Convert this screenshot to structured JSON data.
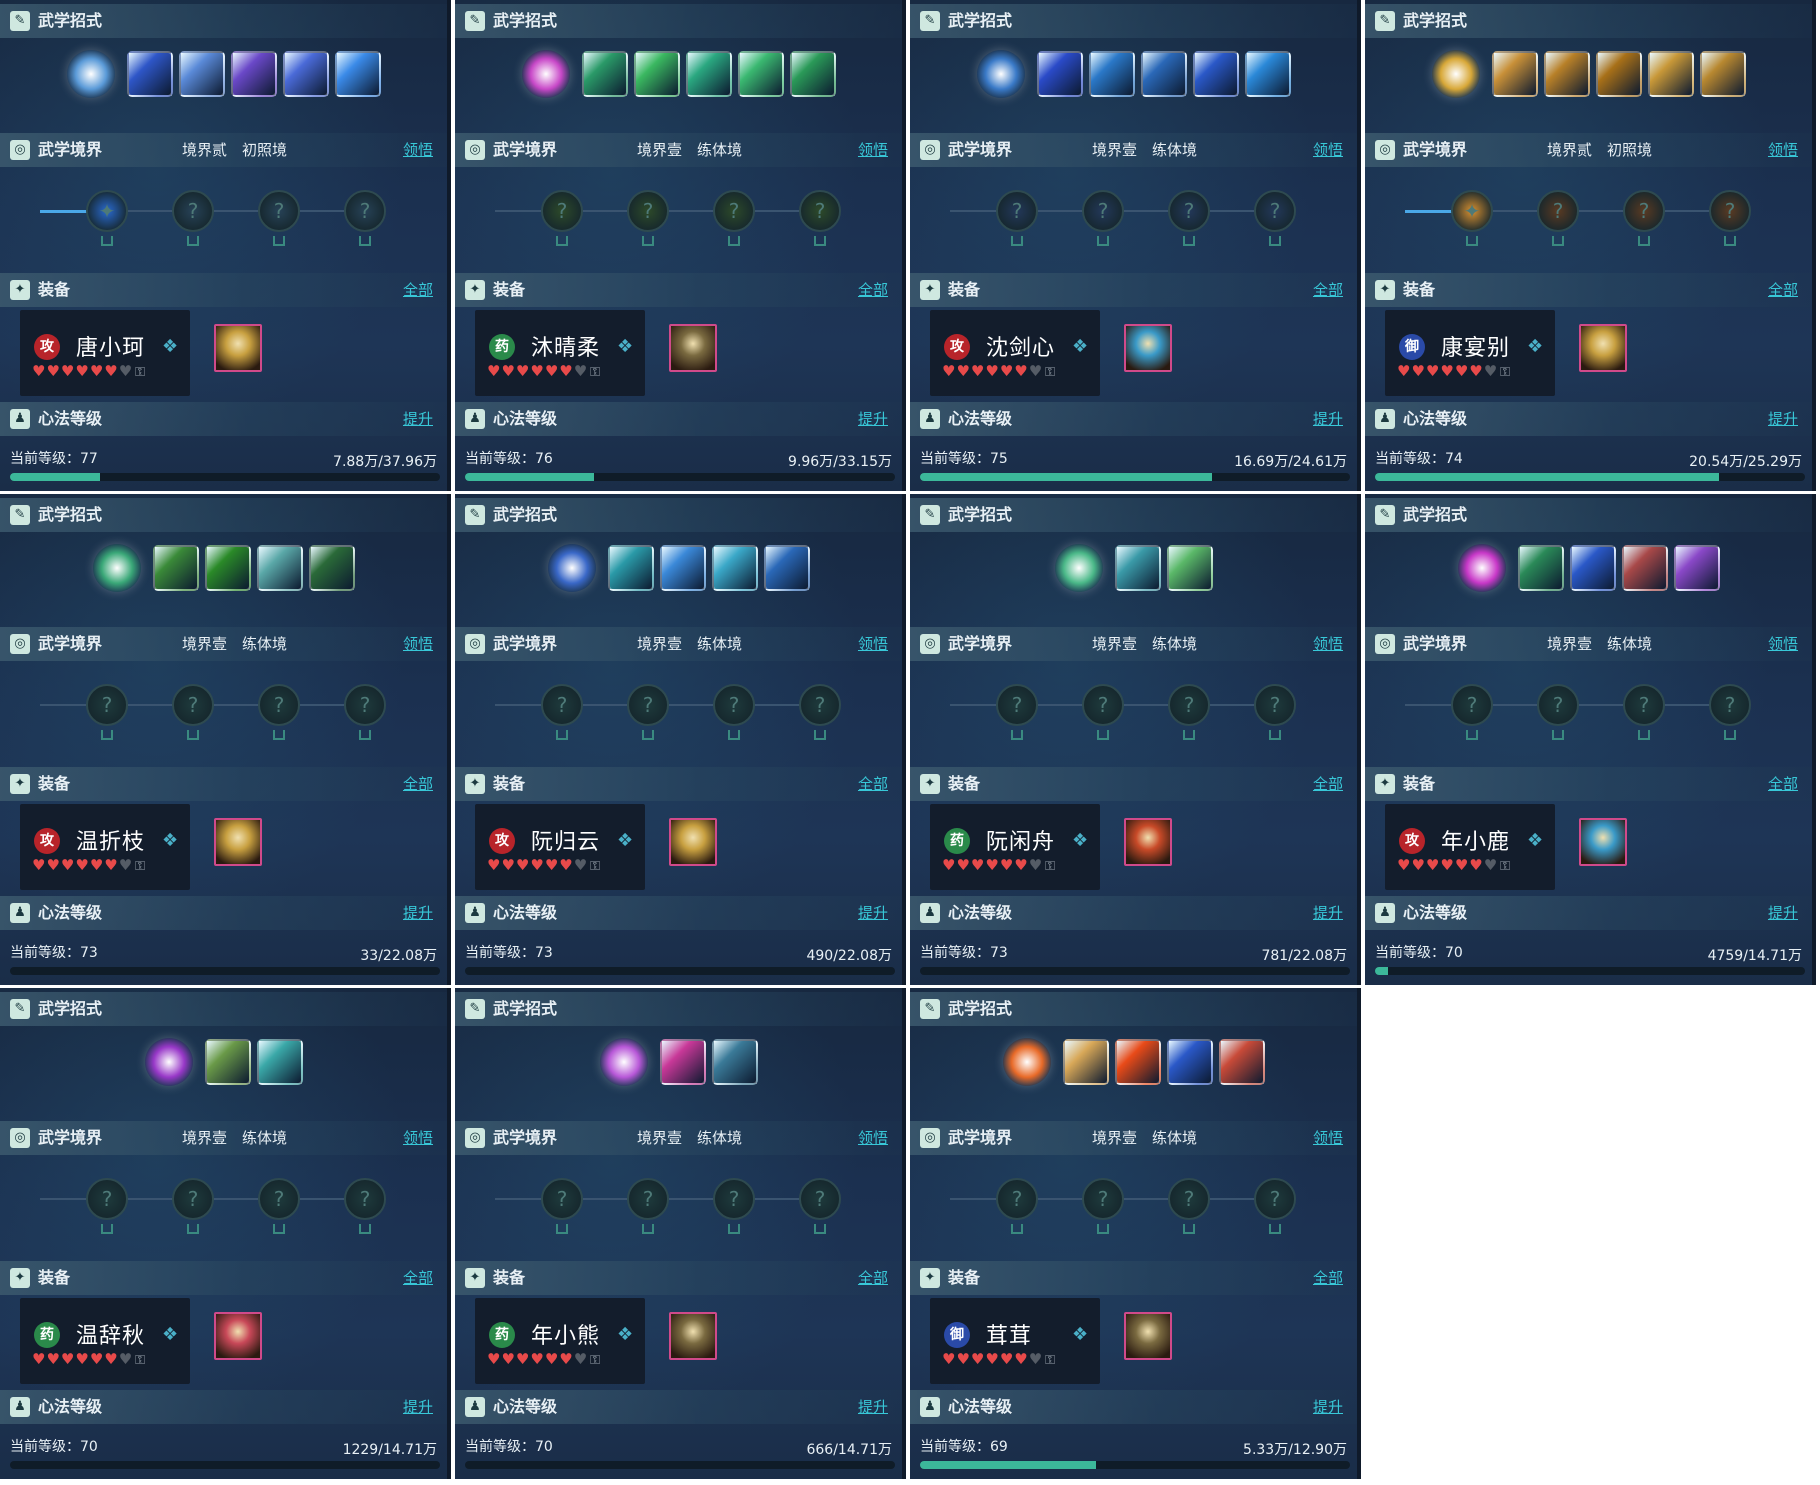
{
  "labels": {
    "skills": "武学招式",
    "realm": "武学境界",
    "equip": "装备",
    "equip_all": "全部",
    "realm_link": "领悟",
    "heart": "心法等级",
    "heart_link": "提升",
    "level_prefix": "当前等级："
  },
  "panels": [
    {
      "name": "唐小珂",
      "class_badge": "攻",
      "badge_color": "#b8242a",
      "realm_tier": "境界贰",
      "realm_stage": "初照境",
      "realm_active": true,
      "level": "77",
      "exp": "7.88万/37.96万",
      "progress": 0.21,
      "hearts_full": 6,
      "hearts_empty": 1,
      "skill_main_color": "#5a9ad8",
      "skill_colors": [
        "#2e56c8",
        "#5a8ad8",
        "#6a48c8",
        "#4a6ad8",
        "#3a8ae8"
      ],
      "node_colors": [
        "#2a6ad0",
        "#274257",
        "#274257",
        "#274257"
      ],
      "gear_color": "#c8a040"
    },
    {
      "name": "沐晴柔",
      "class_badge": "药",
      "badge_color": "#2a8a4a",
      "realm_tier": "境界壹",
      "realm_stage": "练体境",
      "realm_active": false,
      "level": "76",
      "exp": "9.96万/33.15万",
      "progress": 0.3,
      "hearts_full": 6,
      "hearts_empty": 1,
      "skill_main_color": "#c848c8",
      "skill_colors": [
        "#2a9a68",
        "#3ab860",
        "#2aa880",
        "#3ab870",
        "#2a9a58"
      ],
      "node_colors": [
        "#2d4a2a",
        "#2d4a2a",
        "#2d4a2a",
        "#2d4a2a"
      ],
      "gear_color": "#7a6a40"
    },
    {
      "name": "沈剑心",
      "class_badge": "攻",
      "badge_color": "#b8242a",
      "realm_tier": "境界壹",
      "realm_stage": "练体境",
      "realm_active": false,
      "level": "75",
      "exp": "16.69万/24.61万",
      "progress": 0.68,
      "hearts_full": 6,
      "hearts_empty": 1,
      "skill_main_color": "#3a7ac8",
      "skill_colors": [
        "#2a4ac8",
        "#2a78c8",
        "#2a68b8",
        "#2a58c8",
        "#2a88d8"
      ],
      "node_colors": [
        "#23385a",
        "#23385a",
        "#23385a",
        "#23385a"
      ],
      "gear_color": "#3a9ac8"
    },
    {
      "name": "康宴别",
      "class_badge": "御",
      "badge_color": "#2a4aa8",
      "realm_tier": "境界贰",
      "realm_stage": "初照境",
      "realm_active": true,
      "level": "74",
      "exp": "20.54万/25.29万",
      "progress": 0.8,
      "hearts_full": 6,
      "hearts_empty": 1,
      "skill_main_color": "#d8a838",
      "skill_colors": [
        "#c89038",
        "#b88028",
        "#a87018",
        "#c89838",
        "#b88830"
      ],
      "node_colors": [
        "#d89030",
        "#5a3a22",
        "#5a3a22",
        "#5a3a22"
      ],
      "gear_color": "#c8a040"
    },
    {
      "name": "温折枝",
      "class_badge": "攻",
      "badge_color": "#b8242a",
      "realm_tier": "境界壹",
      "realm_stage": "练体境",
      "realm_active": false,
      "level": "73",
      "exp": "33/22.08万",
      "progress": 0.0,
      "hearts_full": 6,
      "hearts_empty": 1,
      "skill_main_color": "#3aa878",
      "skill_colors": [
        "#3a8a38",
        "#2a8a28",
        "#5aa8a8",
        "#2a6a38"
      ],
      "node_colors": [
        "#1e3a3c",
        "#1e3a3c",
        "#1e3a3c",
        "#1e3a3c"
      ],
      "gear_color": "#c8a040"
    },
    {
      "name": "阮归云",
      "class_badge": "攻",
      "badge_color": "#b8242a",
      "realm_tier": "境界壹",
      "realm_stage": "练体境",
      "realm_active": false,
      "level": "73",
      "exp": "490/22.08万",
      "progress": 0.0,
      "hearts_full": 6,
      "hearts_empty": 1,
      "skill_main_color": "#3a68c8",
      "skill_colors": [
        "#2a9aa8",
        "#3a88d8",
        "#3aa8c8",
        "#2a68b8"
      ],
      "node_colors": [
        "#1e3a3c",
        "#1e3a3c",
        "#1e3a3c",
        "#1e3a3c"
      ],
      "gear_color": "#c8a040"
    },
    {
      "name": "阮闲舟",
      "class_badge": "药",
      "badge_color": "#2a8a4a",
      "realm_tier": "境界壹",
      "realm_stage": "练体境",
      "realm_active": false,
      "level": "73",
      "exp": "781/22.08万",
      "progress": 0.0,
      "hearts_full": 6,
      "hearts_empty": 1,
      "skill_main_color": "#4ab888",
      "skill_colors": [
        "#3a9aa8",
        "#5ab868"
      ],
      "node_colors": [
        "#1e3a3c",
        "#1e3a3c",
        "#1e3a3c",
        "#1e3a3c"
      ],
      "gear_color": "#c84a28"
    },
    {
      "name": "年小鹿",
      "class_badge": "攻",
      "badge_color": "#b8242a",
      "realm_tier": "境界壹",
      "realm_stage": "练体境",
      "realm_active": false,
      "level": "70",
      "exp": "4759/14.71万",
      "progress": 0.03,
      "hearts_full": 6,
      "hearts_empty": 1,
      "skill_main_color": "#c838c8",
      "skill_colors": [
        "#2a8a58",
        "#2a58c8",
        "#a84848",
        "#8a48c8"
      ],
      "node_colors": [
        "#1e3a3c",
        "#1e3a3c",
        "#1e3a3c",
        "#1e3a3c"
      ],
      "gear_color": "#3a9ac8"
    },
    {
      "name": "温辞秋",
      "class_badge": "药",
      "badge_color": "#2a8a4a",
      "realm_tier": "境界壹",
      "realm_stage": "练体境",
      "realm_active": false,
      "level": "70",
      "exp": "1229/14.71万",
      "progress": 0.0,
      "hearts_full": 6,
      "hearts_empty": 1,
      "skill_main_color": "#9838c8",
      "skill_colors": [
        "#6a9a48",
        "#3aa8a8"
      ],
      "node_colors": [
        "#1e3a3c",
        "#1e3a3c",
        "#1e3a3c",
        "#1e3a3c"
      ],
      "gear_color": "#c84858"
    },
    {
      "name": "年小熊",
      "class_badge": "药",
      "badge_color": "#2a8a4a",
      "realm_tier": "境界壹",
      "realm_stage": "练体境",
      "realm_active": false,
      "level": "70",
      "exp": "666/14.71万",
      "progress": 0.0,
      "hearts_full": 6,
      "hearts_empty": 1,
      "skill_main_color": "#b858d8",
      "skill_colors": [
        "#c83898",
        "#3a7a98"
      ],
      "node_colors": [
        "#1e3a3c",
        "#1e3a3c",
        "#1e3a3c",
        "#1e3a3c"
      ],
      "gear_color": "#7a6a40"
    },
    {
      "name": "茸茸",
      "class_badge": "御",
      "badge_color": "#2a4aa8",
      "realm_tier": "境界壹",
      "realm_stage": "练体境",
      "realm_active": false,
      "level": "69",
      "exp": "5.33万/12.90万",
      "progress": 0.41,
      "hearts_full": 6,
      "hearts_empty": 1,
      "skill_main_color": "#e86a28",
      "skill_colors": [
        "#d8a858",
        "#e84a18",
        "#2a58c8",
        "#c84a38"
      ],
      "node_colors": [
        "#1e3a3c",
        "#1e3a3c",
        "#1e3a3c",
        "#1e3a3c"
      ],
      "gear_color": "#7a6a40"
    }
  ]
}
